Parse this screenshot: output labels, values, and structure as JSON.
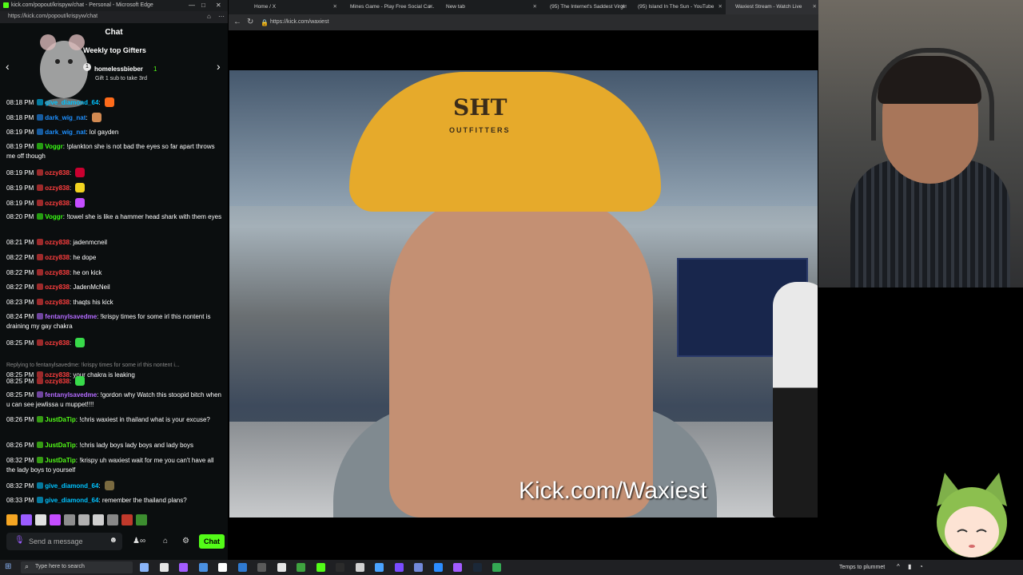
{
  "chat_window": {
    "title": "kick.com/popout/krispyw/chat - Personal - Microsoft Edge",
    "url": "https://kick.com/popout/krispyw/chat",
    "header": "Chat",
    "gifters": {
      "title": "Weekly top Gifters",
      "rank": "1",
      "name": "homelessbieber",
      "count": "1",
      "gift_text": "Gift 1 sub to take 3rd"
    },
    "messages": [
      {
        "time": "08:18 PM",
        "user": "give_diamond_64",
        "user_color": "#00c3ff",
        "text": "",
        "emote": "#ff6b1a"
      },
      {
        "time": "08:18 PM",
        "user": "dark_wig_nat",
        "user_color": "#1e90ff",
        "text": "",
        "emote": "#d28a52"
      },
      {
        "time": "08:19 PM",
        "user": "dark_wig_nat",
        "user_color": "#1e90ff",
        "text": "lol gayden",
        "emote": ""
      },
      {
        "time": "08:19 PM",
        "user": "Voggr",
        "user_color": "#39ff14",
        "text": "!plankton she is not bad the eyes so far apart throws me off though",
        "emote": ""
      },
      {
        "time": "08:19 PM",
        "user": "ozzy838",
        "user_color": "#ff3e3e",
        "text": "",
        "emote": "#c9002f"
      },
      {
        "time": "08:19 PM",
        "user": "ozzy838",
        "user_color": "#ff3e3e",
        "text": "",
        "emote": "#f2d320"
      },
      {
        "time": "08:19 PM",
        "user": "ozzy838",
        "user_color": "#ff3e3e",
        "text": "",
        "emote": "#c44dff"
      },
      {
        "time": "08:20 PM",
        "user": "Voggr",
        "user_color": "#39ff14",
        "text": "!towel she is like a hammer head shark with them eyes",
        "emote": ""
      },
      {
        "time": "08:21 PM",
        "user": "ozzy838",
        "user_color": "#ff3e3e",
        "text": "jadenmcneil",
        "emote": ""
      },
      {
        "time": "08:22 PM",
        "user": "ozzy838",
        "user_color": "#ff3e3e",
        "text": "he dope",
        "emote": ""
      },
      {
        "time": "08:22 PM",
        "user": "ozzy838",
        "user_color": "#ff3e3e",
        "text": "he on kick",
        "emote": ""
      },
      {
        "time": "08:22 PM",
        "user": "ozzy838",
        "user_color": "#ff3e3e",
        "text": "JadenMcNeil",
        "emote": ""
      },
      {
        "time": "08:23 PM",
        "user": "ozzy838",
        "user_color": "#ff3e3e",
        "text": "thaqts his kick",
        "emote": ""
      },
      {
        "time": "08:24 PM",
        "user": "fentanylsavedme",
        "user_color": "#b46bff",
        "text": "!krispy times for some irl this nontent is draining my gay chakra",
        "emote": ""
      },
      {
        "time": "08:25 PM",
        "user": "ozzy838",
        "user_color": "#ff3e3e",
        "text": "",
        "emote": "#38d94a"
      },
      {
        "time": "08:25 PM",
        "user": "ozzy838",
        "user_color": "#ff3e3e",
        "text": "your chakra is leaking",
        "emote": "",
        "reply": "Replying to fentanylsavedme: !krispy times for some irl this nontent i..."
      },
      {
        "time": "08:25 PM",
        "user": "ozzy838",
        "user_color": "#ff3e3e",
        "text": "",
        "emote": "#38d94a"
      },
      {
        "time": "08:25 PM",
        "user": "fentanylsavedme",
        "user_color": "#b46bff",
        "text": "!gordon why Watch this stoopid bitch when u can see jewlissa u muppet!!!!",
        "emote": ""
      },
      {
        "time": "08:26 PM",
        "user": "JustDaTip",
        "user_color": "#53fc18",
        "text": "!chris waxiest in thailand what is your excuse?",
        "emote": ""
      },
      {
        "time": "08:26 PM",
        "user": "JustDaTip",
        "user_color": "#53fc18",
        "text": "!chris lady boys lady boys and lady boys",
        "emote": ""
      },
      {
        "time": "08:32 PM",
        "user": "JustDaTip",
        "user_color": "#53fc18",
        "text": "!krispy uh waxiest wait for me you can't have all the lady boys to yourself",
        "emote": ""
      },
      {
        "time": "08:32 PM",
        "user": "give_diamond_64",
        "user_color": "#00c3ff",
        "text": "",
        "emote": "#7a6a40"
      },
      {
        "time": "08:33 PM",
        "user": "give_diamond_64",
        "user_color": "#00c3ff",
        "text": "remember the thailand plans?",
        "emote": ""
      }
    ],
    "input_placeholder": "Send a message",
    "send_label": "Chat",
    "emote_colors": [
      "#f5a623",
      "#9b5cff",
      "#e0e0e0",
      "#c44dff",
      "#8d8d8d",
      "#b0b0b0",
      "#cfcfcf",
      "#888888",
      "#c0392b",
      "#3c8d2f"
    ]
  },
  "browser": {
    "tabs": [
      {
        "label": "Home / X",
        "active": false
      },
      {
        "label": "Mines Game - Play Free Social Ca...",
        "active": false
      },
      {
        "label": "New tab",
        "active": false
      },
      {
        "label": "(95) The Internet's Saddest Virgin...",
        "active": false
      },
      {
        "label": "(95) Island In The Sun - YouTube",
        "active": false
      },
      {
        "label": "Waxiest Stream - Watch Live",
        "active": true
      }
    ],
    "url": "https://kick.com/waxiest"
  },
  "stream": {
    "watermark": "Kick.com/Waxiest",
    "cap_logo_top": "SHT",
    "cap_logo_bottom": "OUTFITTERS"
  },
  "taskbar": {
    "search_placeholder": "Type here to search",
    "weather": "Temps to plummet",
    "icon_colors": [
      "#8ab4f8",
      "#e6e6e6",
      "#a35cff",
      "#4a90e2",
      "#ffffff",
      "#2f7ad1",
      "#5a5a5a",
      "#e6e6e6",
      "#3fa33f",
      "#53fc18",
      "#2b2b2b",
      "#d1d1d1",
      "#4aa3ff",
      "#7a4cff",
      "#7289da",
      "#2b8cff",
      "#a35cff",
      "#1b2838",
      "#34a853"
    ]
  }
}
